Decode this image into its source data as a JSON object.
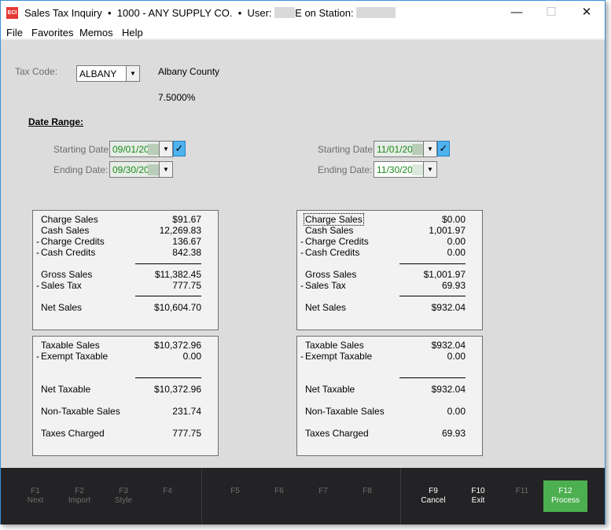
{
  "window": {
    "title_app": "Sales Tax Inquiry",
    "title_company": "1000 - ANY SUPPLY CO.",
    "title_user_label": "User:",
    "title_user_suffix": "E on Station:",
    "logo_text": "ECI",
    "controls": [
      "minimize",
      "maximize",
      "close"
    ]
  },
  "menu": [
    "File",
    "Favorites",
    "Memos",
    "Help"
  ],
  "tax": {
    "label": "Tax Code:",
    "code": "ALBANY",
    "description": "Albany County",
    "rate": "7.5000%"
  },
  "date_range": {
    "heading": "Date Range:",
    "start_label": "Starting Date:",
    "end_label": "Ending Date:",
    "left": {
      "start": "09/01/20",
      "end": "09/30/20",
      "start_checked": true
    },
    "right": {
      "start": "11/01/20",
      "end": "11/30/20",
      "start_checked": true
    }
  },
  "panels": {
    "left": {
      "sales": [
        {
          "pre": "",
          "label": "Charge Sales",
          "value": "$91.67"
        },
        {
          "pre": "",
          "label": "Cash Sales",
          "value": "12,269.83"
        },
        {
          "pre": "-",
          "label": "Charge Credits",
          "value": "136.67"
        },
        {
          "pre": "-",
          "label": "Cash Credits",
          "value": "842.38"
        },
        {
          "pre": "",
          "label": "Gross Sales",
          "value": "$11,382.45"
        },
        {
          "pre": "-",
          "label": "Sales Tax",
          "value": "777.75"
        },
        {
          "pre": "",
          "label": "Net Sales",
          "value": "$10,604.70"
        }
      ],
      "taxable": [
        {
          "pre": "",
          "label": "Taxable Sales",
          "value": "$10,372.96"
        },
        {
          "pre": "-",
          "label": "Exempt Taxable",
          "value": "0.00"
        },
        {
          "pre": "",
          "label": "Net Taxable",
          "value": "$10,372.96"
        },
        {
          "pre": "",
          "label": "Non-Taxable Sales",
          "value": "231.74"
        },
        {
          "pre": "",
          "label": "Taxes Charged",
          "value": "777.75"
        }
      ]
    },
    "right": {
      "sales": [
        {
          "pre": "",
          "label": "Charge Sales",
          "value": "$0.00"
        },
        {
          "pre": "",
          "label": "Cash Sales",
          "value": "1,001.97"
        },
        {
          "pre": "-",
          "label": "Charge Credits",
          "value": "0.00"
        },
        {
          "pre": "-",
          "label": "Cash Credits",
          "value": "0.00"
        },
        {
          "pre": "",
          "label": "Gross Sales",
          "value": "$1,001.97"
        },
        {
          "pre": "-",
          "label": "Sales Tax",
          "value": "69.93"
        },
        {
          "pre": "",
          "label": "Net Sales",
          "value": "$932.04"
        }
      ],
      "taxable": [
        {
          "pre": "",
          "label": "Taxable Sales",
          "value": "$932.04"
        },
        {
          "pre": "-",
          "label": "Exempt Taxable",
          "value": "0.00"
        },
        {
          "pre": "",
          "label": "Net Taxable",
          "value": "$932.04"
        },
        {
          "pre": "",
          "label": "Non-Taxable Sales",
          "value": "0.00"
        },
        {
          "pre": "",
          "label": "Taxes Charged",
          "value": "69.93"
        }
      ]
    }
  },
  "function_keys": [
    {
      "key": "F1",
      "label": "Next",
      "enabled": false
    },
    {
      "key": "F2",
      "label": "Import",
      "enabled": false
    },
    {
      "key": "F3",
      "label": "Style",
      "enabled": false
    },
    {
      "key": "F4",
      "label": "",
      "enabled": false
    },
    {
      "key": "F5",
      "label": "",
      "enabled": false
    },
    {
      "key": "F6",
      "label": "",
      "enabled": false
    },
    {
      "key": "F7",
      "label": "",
      "enabled": false
    },
    {
      "key": "F8",
      "label": "",
      "enabled": false
    },
    {
      "key": "F9",
      "label": "Cancel",
      "enabled": true
    },
    {
      "key": "F10",
      "label": "Exit",
      "enabled": true
    },
    {
      "key": "F11",
      "label": "",
      "enabled": false
    },
    {
      "key": "F12",
      "label": "Process",
      "enabled": true
    }
  ],
  "colors": {
    "accent_green": "#4caf50",
    "footer_bg": "#232325",
    "date_text": "#1a8a1a",
    "checkbox": "#4fb3ef"
  }
}
